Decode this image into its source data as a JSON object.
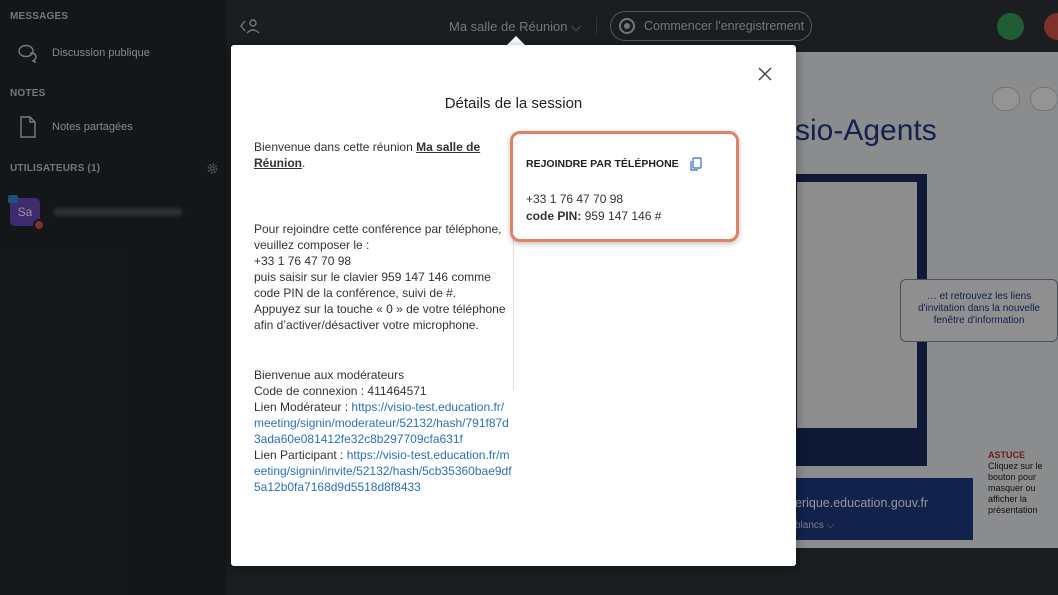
{
  "sidebar": {
    "messages_title": "MESSAGES",
    "public_chat": "Discussion publique",
    "notes_title": "NOTES",
    "shared_notes": "Notes partagées",
    "users_title": "UTILISATEURS (1)",
    "user_initials": "Sa"
  },
  "topbar": {
    "room_name": "Ma salle de Réunion ⌵",
    "record_label": "Commencer l'enregistrement"
  },
  "presentation": {
    "title_fragment": "sio-Agents",
    "callout": "… et retrouvez les liens d'invitation dans la nouvelle fenêtre d'information",
    "url_text": "erique.education.gouv.fr",
    "url_sub": "blancs ⌵",
    "tip_title": "ASTUCE",
    "tip_text": "Cliquez sur le bouton pour masquer ou afficher la présentation"
  },
  "modal": {
    "title": "Détails de la session",
    "welcome_prefix": "Bienvenue dans cette réunion ",
    "room_name": "Ma salle de Réunion",
    "welcome_suffix": ".",
    "phone_instructions_1": "Pour rejoindre cette conférence par téléphone, veuillez composer le :",
    "phone_number": "+33 1 76 47 70 98",
    "phone_instructions_2": "puis saisir sur le clavier 959 147 146 comme code PIN de la conférence, suivi de #.",
    "phone_instructions_3": "Appuyez sur la touche « 0 » de votre téléphone afin d’activer/désactiver votre microphone.",
    "moderators_welcome": "Bienvenue aux modérateurs",
    "connection_code": "Code de connexion : 411464571",
    "moderator_link_label": "Lien Modérateur  : ",
    "moderator_link": "https://visio-test.education.fr/meeting/signin/moderateur/52132/hash/791f87d3ada60e081412fe32c8b297709cfa631f",
    "participant_link_label": "Lien Participant  : ",
    "participant_link": "https://visio-test.education.fr/meeting/signin/invite/52132/hash/5cb35360bae9df5a12b0fa7168d9d5518d8f8433",
    "phone_box": {
      "title": "REJOINDRE PAR TÉLÉPHONE",
      "number": "+33 1 76 47 70 98",
      "pin_label": "code PIN:",
      "pin_value": " 959 147 146 #"
    }
  },
  "colors": {
    "accent": "#2770c5",
    "highlight_border": "#e28162",
    "sidebar_bg": "#23292d",
    "avatar": "#6c4bc1"
  }
}
